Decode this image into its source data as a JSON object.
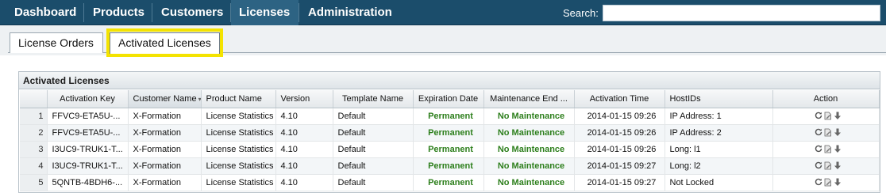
{
  "nav": {
    "items": [
      "Dashboard",
      "Products",
      "Customers",
      "Licenses",
      "Administration"
    ],
    "search_label": "Search:",
    "search_value": ""
  },
  "tabs": [
    "License Orders",
    "Activated Licenses"
  ],
  "panel": {
    "title": "Activated Licenses",
    "columns": [
      "Activation Key",
      "Customer Name",
      "Product Name",
      "Version",
      "Template Name",
      "Expiration Date",
      "Maintenance End ...",
      "Activation Time",
      "HostIDs",
      "Action"
    ],
    "rows": [
      {
        "num": "1",
        "key": "FFVC9-ETA5U-...",
        "customer": "X-Formation",
        "product": "License Statistics",
        "version": "4.10",
        "template": "Default",
        "expiration": "Permanent",
        "maintenance": "No Maintenance",
        "time": "2014-01-15 09:26",
        "hostids": "IP Address: 1"
      },
      {
        "num": "2",
        "key": "FFVC9-ETA5U-...",
        "customer": "X-Formation",
        "product": "License Statistics",
        "version": "4.10",
        "template": "Default",
        "expiration": "Permanent",
        "maintenance": "No Maintenance",
        "time": "2014-01-15 09:26",
        "hostids": "IP Address: 2"
      },
      {
        "num": "3",
        "key": "I3UC9-TRUK1-T...",
        "customer": "X-Formation",
        "product": "License Statistics",
        "version": "4.10",
        "template": "Default",
        "expiration": "Permanent",
        "maintenance": "No Maintenance",
        "time": "2014-01-15 09:26",
        "hostids": "Long: l1"
      },
      {
        "num": "4",
        "key": "I3UC9-TRUK1-T...",
        "customer": "X-Formation",
        "product": "License Statistics",
        "version": "4.10",
        "template": "Default",
        "expiration": "Permanent",
        "maintenance": "No Maintenance",
        "time": "2014-01-15 09:27",
        "hostids": "Long: l2"
      },
      {
        "num": "5",
        "key": "5QNTB-4BDH6-...",
        "customer": "X-Formation",
        "product": "License Statistics",
        "version": "4.10",
        "template": "Default",
        "expiration": "Permanent",
        "maintenance": "No Maintenance",
        "time": "2014-01-15 09:27",
        "hostids": "Not Locked"
      }
    ],
    "action_icons": [
      "refresh-icon",
      "edit-icon",
      "download-icon"
    ]
  },
  "colors": {
    "nav_bg": "#1b4d6b",
    "highlight": "#f4e300",
    "status_green": "#2d7f1c"
  }
}
